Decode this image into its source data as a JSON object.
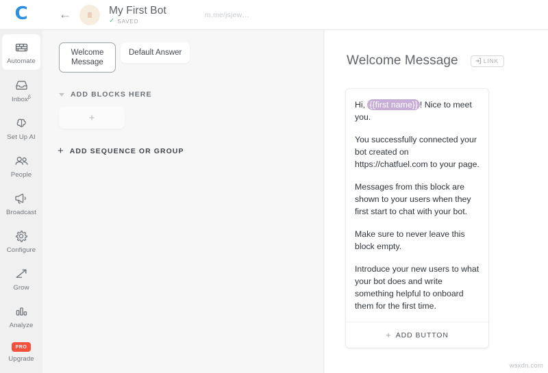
{
  "topbar": {
    "logo_letter": "C",
    "back_icon": "←",
    "bot_name": "My First Bot",
    "saved_check": "✓",
    "saved_label": "SAVED",
    "bot_url": "m.me/jsjew…"
  },
  "sidebar": {
    "items": [
      {
        "label": "Automate",
        "icon": "automate-icon",
        "active": true
      },
      {
        "label": "Inbox",
        "sup": "β",
        "icon": "inbox-icon",
        "active": false
      },
      {
        "label": "Set Up AI",
        "icon": "ai-brain-icon",
        "active": false
      },
      {
        "label": "People",
        "icon": "people-icon",
        "active": false
      },
      {
        "label": "Broadcast",
        "icon": "megaphone-icon",
        "active": false
      },
      {
        "label": "Configure",
        "icon": "gear-icon",
        "active": false
      },
      {
        "label": "Grow",
        "icon": "growth-arrow-icon",
        "active": false
      },
      {
        "label": "Analyze",
        "icon": "bar-chart-icon",
        "active": false
      },
      {
        "label": "Upgrade",
        "icon": "pro-badge-icon",
        "badge": "PRO",
        "active": false
      }
    ]
  },
  "canvas": {
    "tabs": [
      {
        "label": "Welcome Message",
        "active": true
      },
      {
        "label": "Default Answer",
        "active": false
      }
    ],
    "section_title": "ADD BLOCKS HERE",
    "add_block_plus": "+",
    "add_sequence_plus": "+",
    "add_sequence_label": "ADD SEQUENCE OR GROUP"
  },
  "panel": {
    "title": "Welcome Message",
    "link_label": "LINK",
    "message": {
      "greeting_before": "Hi, ",
      "token": "{{first name}}",
      "greeting_after": "! Nice to meet you.",
      "paragraphs": [
        "You successfully connected your bot created on https://chatfuel.com to your page.",
        "Messages from this block are shown to your users when they first start to chat with your bot.",
        "Make sure to never leave this block empty.",
        "Introduce your new users to what your bot does and write something helpful to onboard them for the first time."
      ]
    },
    "add_button_plus": "+",
    "add_button_label": "ADD BUTTON"
  },
  "watermark": "wsxdn.com",
  "colors": {
    "brand_blue": "#2d8fe0",
    "saved_green": "#4cc38a",
    "pro_red": "#f4503c",
    "token_purple": "#c7aed6",
    "active_tab_border": "#9aa5ad"
  }
}
